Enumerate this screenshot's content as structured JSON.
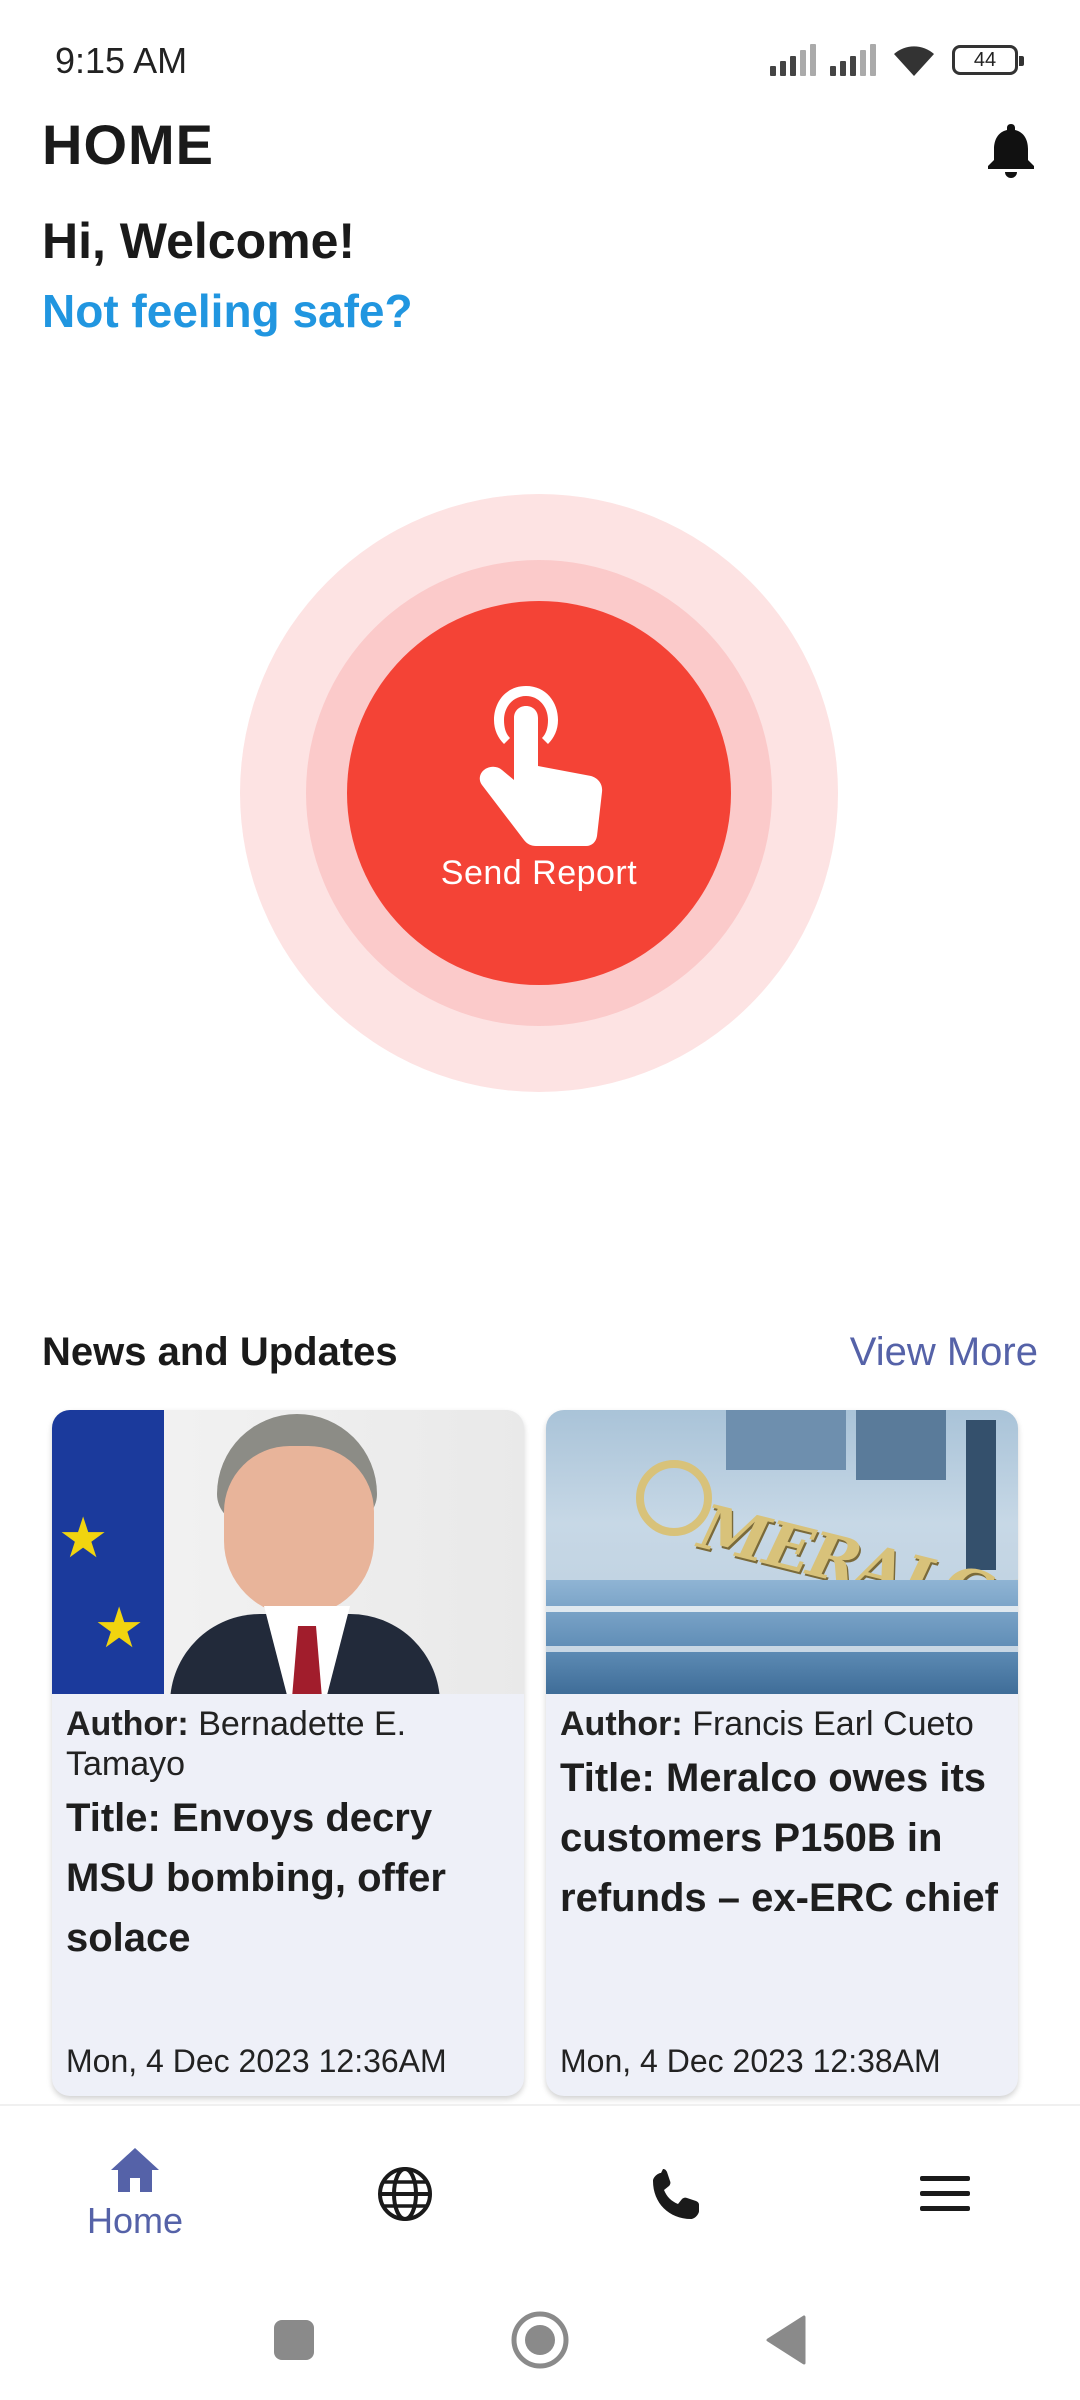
{
  "status_bar": {
    "time": "9:15 AM",
    "battery": "44",
    "icons": [
      "signal-icon",
      "signal-icon",
      "wifi-icon",
      "battery-icon"
    ]
  },
  "header": {
    "title": "HOME",
    "notification_icon": "bell-icon"
  },
  "greeting": {
    "welcome": "Hi, Welcome!",
    "prompt": "Not feeling safe?"
  },
  "sos": {
    "label": "Send Report",
    "icon": "tap-hand-icon",
    "colors": {
      "button": "#f44336",
      "ring_inner": "#fbcaca",
      "ring_outer": "#fde3e3"
    }
  },
  "news": {
    "title": "News and Updates",
    "view_more": "View More",
    "author_label": "Author:",
    "items": [
      {
        "author": "Bernadette E. Tamayo",
        "headline": "Title: Envoys decry MSU bombing, offer solace",
        "date": "Mon, 4 Dec 2023 12:36AM"
      },
      {
        "author": "Francis Earl Cueto",
        "headline": "Title: Meralco owes its customers P150B in refunds – ex-ERC chief",
        "date": "Mon, 4 Dec 2023 12:38AM",
        "image_text": "MERALCO"
      }
    ]
  },
  "bottom_nav": {
    "items": [
      {
        "label": "Home",
        "icon": "home-icon",
        "active": true
      },
      {
        "label": "",
        "icon": "globe-icon",
        "active": false
      },
      {
        "label": "",
        "icon": "phone-icon",
        "active": false
      },
      {
        "label": "",
        "icon": "menu-icon",
        "active": false
      }
    ],
    "active_color": "#5562a8"
  },
  "system_nav": {
    "icons": [
      "recents-icon",
      "home-circle-icon",
      "back-icon"
    ]
  }
}
